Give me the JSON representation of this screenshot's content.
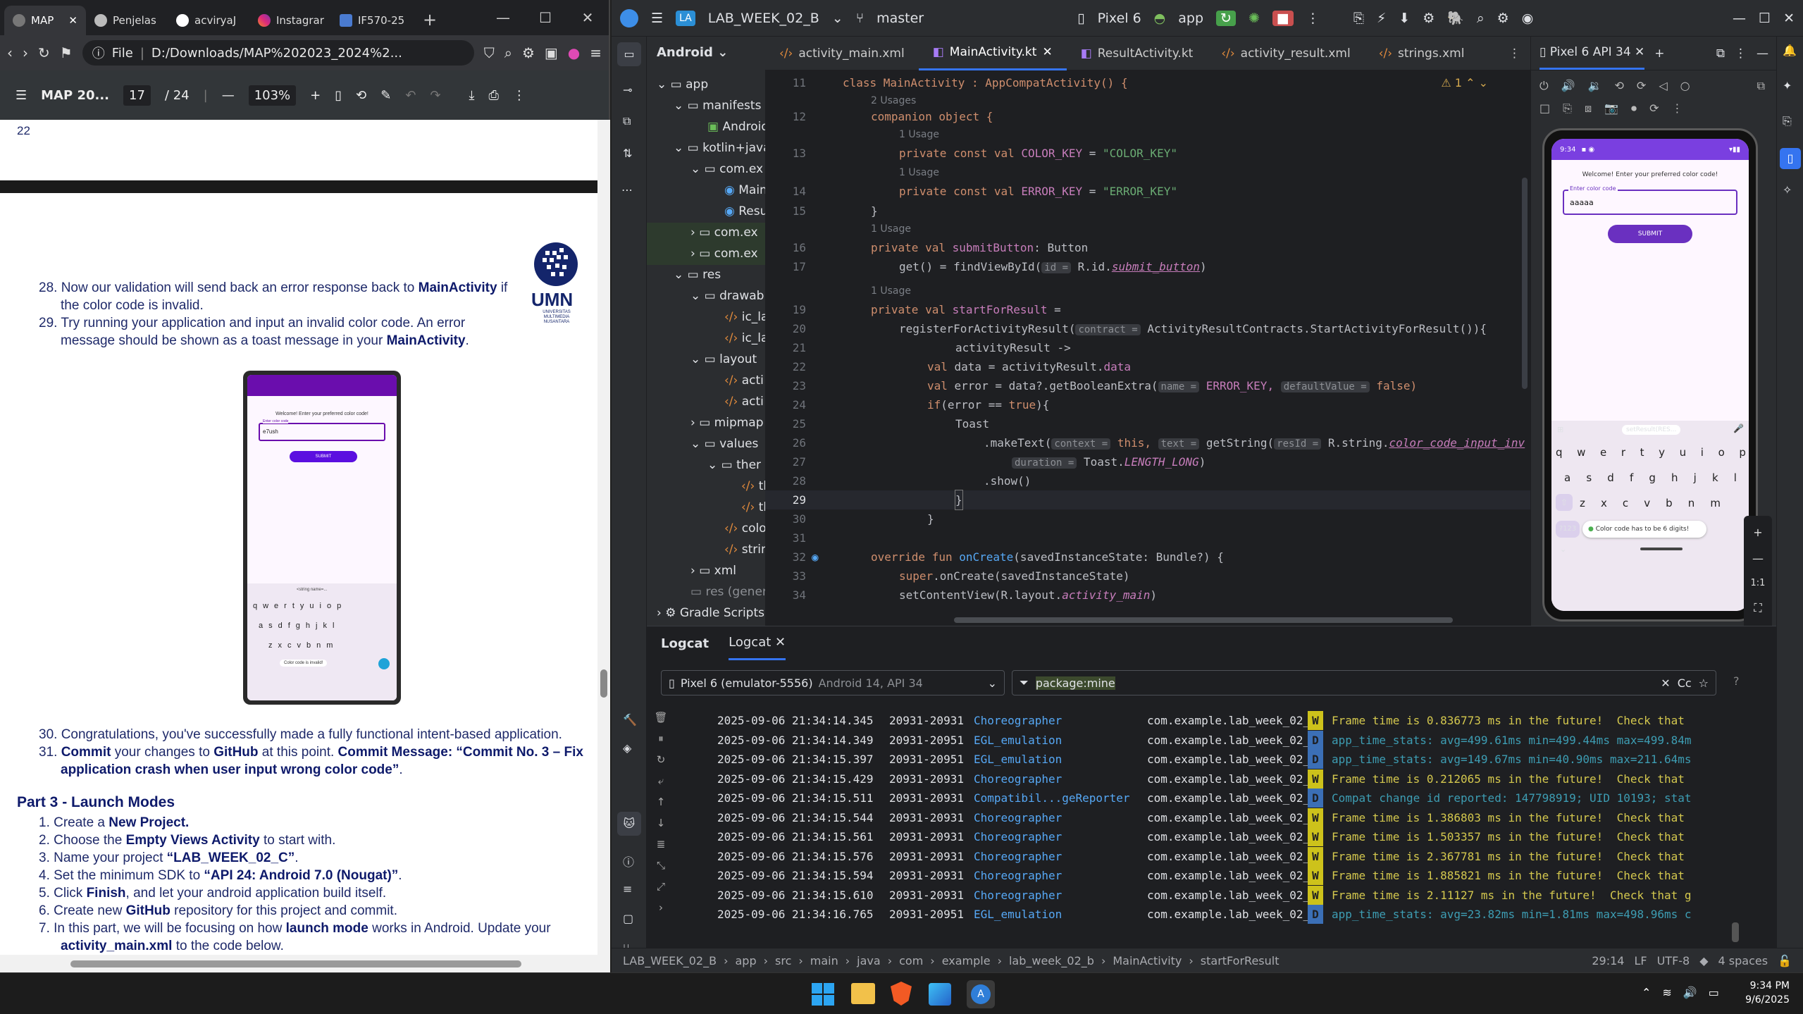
{
  "browser": {
    "tabs": [
      "MAP",
      "Penjelas",
      "acviryaJ",
      "Instagrar",
      "IF570-25"
    ],
    "file_label": "File",
    "url": "D:/Downloads/MAP%202023_2024%2...",
    "pdf_title": "MAP 20...",
    "page_current": "17",
    "page_total": "/ 24",
    "zoom": "103%",
    "page_num_top": "22"
  },
  "doc": {
    "s28_a": "28. Now our validation will send back an error response back to ",
    "s28_b": "MainActivity",
    "s28_c": " if",
    "s28_d": "the color code is invalid.",
    "s29_a": "29. Try running your application and input an invalid color code. An error",
    "s29_b": "message should be shown as a toast message in your ",
    "s29_c": "MainActivity",
    "s29_d": ".",
    "s30": "30. Congratulations, you've successfully made a fully functional intent-based application.",
    "s31_a": "31. ",
    "s31_b": "Commit",
    "s31_c": " your changes to ",
    "s31_d": "GitHub",
    "s31_e": " at this point. ",
    "s31_f": "Commit Message: “Commit No. 3 – Fix",
    "s31_g": "application crash when user input wrong color code”",
    "s31_h": ".",
    "part3": "Part 3 - Launch Modes",
    "p1_a": "1.   Create a ",
    "p1_b": "New Project.",
    "p2_a": "2.   Choose the ",
    "p2_b": "Empty Views Activity",
    "p2_c": " to start with.",
    "p3_a": "3.   Name your project ",
    "p3_b": "“LAB_WEEK_02_C”",
    "p3_c": ".",
    "p4_a": "4.   Set the minimum SDK to ",
    "p4_b": "“API 24: Android 7.0 (Nougat)”",
    "p4_c": ".",
    "p5_a": "5.   Click ",
    "p5_b": "Finish",
    "p5_c": ", and let your android application build itself.",
    "p6_a": "6.   Create new ",
    "p6_b": "GitHub",
    "p6_c": " repository for this project and commit.",
    "p7_a": "7.   In this part, we will be focusing on how ",
    "p7_b": "launch mode",
    "p7_c": " works in Android. Update your",
    "p7_d": "activity_main.xml",
    "p7_e": " to the code below.",
    "logo_text": "UMN",
    "logo_sub": "UNIVERSITAS MULTIMEDIA NUSANTARA",
    "ss_welcome": "Welcome! Enter your preferred color code!",
    "ss_label": "Enter color code",
    "ss_input": "e7ush",
    "ss_submit": "SUBMIT",
    "ss_toast": "Color code is invalid!",
    "ss_suggest": "<string name=..."
  },
  "ide": {
    "project_badge": "LA",
    "project_name": "LAB_WEEK_02_B",
    "branch": "master",
    "device": "Pixel 6",
    "run_config": "app",
    "view_mode": "Android",
    "tabs": [
      "activity_main.xml",
      "MainActivity.kt",
      "ResultActivity.kt",
      "activity_result.xml",
      "strings.xml"
    ],
    "emulator_tab": "Pixel 6 API 34",
    "warning_count": "1",
    "tree": [
      "app",
      "manifests",
      "Android",
      "kotlin+java",
      "com.ex",
      "Main",
      "Resu",
      "com.ex",
      "com.ex",
      "res",
      "drawab",
      "ic_la",
      "ic_la",
      "layout",
      "acti",
      "acti",
      "mipmap",
      "values",
      "ther",
      "th",
      "th",
      "colo",
      "strin",
      "xml",
      "res (gener",
      "Gradle Scripts"
    ]
  },
  "code": {
    "l11": "class MainActivity : AppCompatActivity() {",
    "u2": "2 Usages",
    "l12": "companion object {",
    "u1": "1 Usage",
    "l13a": "private const val ",
    "l13b": "COLOR_KEY",
    "l13c": " = ",
    "l13d": "\"COLOR_KEY\"",
    "l14a": "private const val ",
    "l14b": "ERROR_KEY",
    "l14c": " = ",
    "l14d": "\"ERROR_KEY\"",
    "l15": "}",
    "l16a": "private val ",
    "l16b": "submitButton",
    "l16c": ": Button",
    "l17a": "get() = findViewById(",
    "l17h": "id =",
    "l17b": " R.id.",
    "l17c": "submit_button",
    "l17d": ")",
    "l19a": "private val ",
    "l19b": "startForResult",
    "l19c": " =",
    "l20a": "registerForActivityResult(",
    "l20h": "contract =",
    "l20b": " ActivityResultContracts.StartActivityForResult()){",
    "l21": "activityResult ->",
    "l22a": "val ",
    "l22b": "data",
    "l22c": " = activityResult.",
    "l22d": "data",
    "l23a": "val ",
    "l23b": "error",
    "l23c": " = data?.getBooleanExtra(",
    "l23h1": "name =",
    "l23d": " ERROR_KEY, ",
    "l23h2": "defaultValue =",
    "l23e": " false)",
    "l24a": "if",
    "l24b": "(error == ",
    "l24c": "true",
    "l24d": "){",
    "l25": "Toast",
    "l26a": ".makeText(",
    "l26h1": "context =",
    "l26b": " this, ",
    "l26h2": "text =",
    "l26c": " getString(",
    "l26h3": "resId =",
    "l26d": " R.string.",
    "l26e": "color_code_input_inv",
    "l27h": "duration =",
    "l27a": " Toast.",
    "l27b": "LENGTH_LONG",
    "l27c": ")",
    "l28": ".show()",
    "l29": "}",
    "l30": "}",
    "l32a": "override fun ",
    "l32b": "onCreate",
    "l32c": "(savedInstanceState: Bundle?) {",
    "l33a": "super",
    "l33b": ".onCreate(savedInstanceState)",
    "l34a": "setContentView(R.layout.",
    "l34b": "activity_main",
    "l34c": ")",
    "lines": [
      "11",
      "12",
      "13",
      "14",
      "15",
      "16",
      "17",
      "19",
      "20",
      "21",
      "22",
      "23",
      "24",
      "25",
      "26",
      "27",
      "28",
      "29",
      "30",
      "31",
      "32",
      "33",
      "34"
    ]
  },
  "emulator": {
    "time": "9:34",
    "welcome": "Welcome! Enter your preferred color code!",
    "input_label": "Enter color code",
    "input_value": "aaaaa",
    "submit": "SUBMIT",
    "suggestion": "setResult(RES...",
    "toast": "Color code has to be 6 digits!",
    "keys_row1": [
      "q",
      "w",
      "e",
      "r",
      "t",
      "y",
      "u",
      "i",
      "o",
      "p"
    ],
    "keys_row2": [
      "a",
      "s",
      "d",
      "f",
      "g",
      "h",
      "j",
      "k",
      "l"
    ],
    "keys_row3": [
      "z",
      "x",
      "c",
      "v",
      "b",
      "n",
      "m"
    ],
    "sym_key": "?123",
    "zoom_ratio": "1:1"
  },
  "logcat": {
    "tab1": "Logcat",
    "tab2": "Logcat",
    "device": "Pixel 6 (emulator-5556)",
    "device_sub": "Android 14, API 34",
    "filter": "package:mine",
    "filter_case": "Cc",
    "rows": [
      {
        "ts": "2025-09-06 21:34:14.345",
        "pid": "20931-20931",
        "tag": "Choreographer",
        "pkg": "com.example.lab_week_02_b",
        "lvl": "W",
        "msg": "Frame time is 0.836773 ms in the future!  Check that"
      },
      {
        "ts": "2025-09-06 21:34:14.349",
        "pid": "20931-20951",
        "tag": "EGL_emulation",
        "pkg": "com.example.lab_week_02_b",
        "lvl": "D",
        "msg": "app_time_stats: avg=499.61ms min=499.44ms max=499.84m"
      },
      {
        "ts": "2025-09-06 21:34:15.397",
        "pid": "20931-20951",
        "tag": "EGL_emulation",
        "pkg": "com.example.lab_week_02_b",
        "lvl": "D",
        "msg": "app_time_stats: avg=149.67ms min=40.90ms max=211.64ms"
      },
      {
        "ts": "2025-09-06 21:34:15.429",
        "pid": "20931-20931",
        "tag": "Choreographer",
        "pkg": "com.example.lab_week_02_b",
        "lvl": "W",
        "msg": "Frame time is 0.212065 ms in the future!  Check that"
      },
      {
        "ts": "2025-09-06 21:34:15.511",
        "pid": "20931-20931",
        "tag": "Compatibil...geReporter",
        "pkg": "com.example.lab_week_02_b",
        "lvl": "D",
        "msg": "Compat change id reported: 147798919; UID 10193; stat"
      },
      {
        "ts": "2025-09-06 21:34:15.544",
        "pid": "20931-20931",
        "tag": "Choreographer",
        "pkg": "com.example.lab_week_02_b",
        "lvl": "W",
        "msg": "Frame time is 1.386803 ms in the future!  Check that"
      },
      {
        "ts": "2025-09-06 21:34:15.561",
        "pid": "20931-20931",
        "tag": "Choreographer",
        "pkg": "com.example.lab_week_02_b",
        "lvl": "W",
        "msg": "Frame time is 1.503357 ms in the future!  Check that"
      },
      {
        "ts": "2025-09-06 21:34:15.576",
        "pid": "20931-20931",
        "tag": "Choreographer",
        "pkg": "com.example.lab_week_02_b",
        "lvl": "W",
        "msg": "Frame time is 2.367781 ms in the future!  Check that"
      },
      {
        "ts": "2025-09-06 21:34:15.594",
        "pid": "20931-20931",
        "tag": "Choreographer",
        "pkg": "com.example.lab_week_02_b",
        "lvl": "W",
        "msg": "Frame time is 1.885821 ms in the future!  Check that"
      },
      {
        "ts": "2025-09-06 21:34:15.610",
        "pid": "20931-20931",
        "tag": "Choreographer",
        "pkg": "com.example.lab_week_02_b",
        "lvl": "W",
        "msg": "Frame time is 2.11127 ms in the future!  Check that g"
      },
      {
        "ts": "2025-09-06 21:34:16.765",
        "pid": "20931-20951",
        "tag": "EGL_emulation",
        "pkg": "com.example.lab_week_02_b",
        "lvl": "D",
        "msg": "app_time_stats: avg=23.82ms min=1.81ms max=498.96ms c"
      }
    ]
  },
  "statusbar": {
    "crumbs": [
      "LAB_WEEK_02_B",
      "app",
      "src",
      "main",
      "java",
      "com",
      "example",
      "lab_week_02_b",
      "MainActivity",
      "startForResult"
    ],
    "position": "29:14",
    "line_sep": "LF",
    "encoding": "UTF-8",
    "indent": "4 spaces"
  },
  "taskbar": {
    "time": "9:34 PM",
    "date": "9/6/2025"
  },
  "colors": {
    "accent": "#3574f0",
    "warn": "#cdc21b",
    "debug": "#3b6fb6",
    "tag": "#56a8f5",
    "warn_text": "#d4c84e",
    "debug_text": "#3d9db3"
  }
}
